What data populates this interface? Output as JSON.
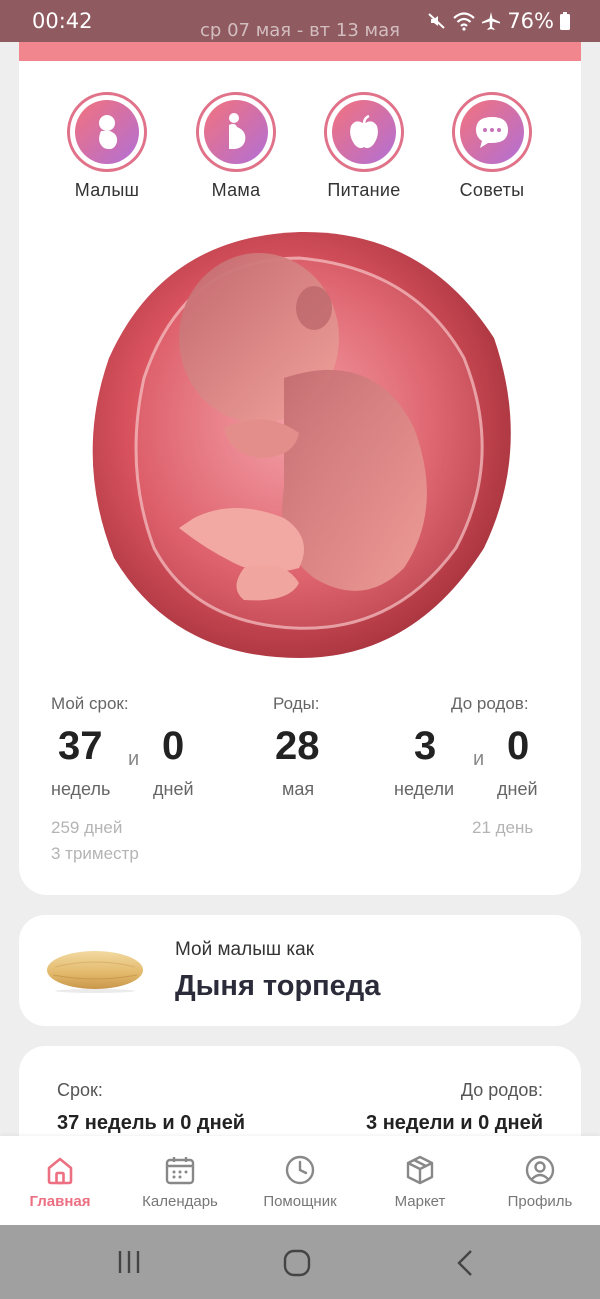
{
  "status_bar": {
    "time": "00:42",
    "battery": "76%"
  },
  "header": {
    "week_range": "ср 07 мая - вт 13 мая"
  },
  "categories": [
    {
      "label": "Малыш",
      "icon": "baby-icon"
    },
    {
      "label": "Мама",
      "icon": "pregnant-woman-icon"
    },
    {
      "label": "Питание",
      "icon": "apple-icon"
    },
    {
      "label": "Советы",
      "icon": "chat-bubble-icon"
    }
  ],
  "stats": {
    "term": {
      "label": "Мой срок:",
      "weeks": "37",
      "and": "и",
      "days": "0",
      "weeks_unit": "недель",
      "days_unit": "дней",
      "total_days": "259 дней",
      "trimester": "3 триместр"
    },
    "birth": {
      "label": "Роды:",
      "day": "28",
      "month": "мая"
    },
    "until": {
      "label": "До родов:",
      "weeks": "3",
      "and": "и",
      "days": "0",
      "weeks_unit": "недели",
      "days_unit": "дней",
      "total_days": "21 день"
    }
  },
  "baby_size": {
    "subtitle": "Мой малыш как",
    "title": "Дыня торпеда"
  },
  "term_card": {
    "term_label": "Срок:",
    "term_value": "37 недель и 0 дней",
    "until_label": "До родов:",
    "until_value": "3 недели и 0 дней"
  },
  "bottom_nav": [
    {
      "label": "Главная",
      "icon": "home-icon",
      "active": true
    },
    {
      "label": "Календарь",
      "icon": "calendar-icon",
      "active": false
    },
    {
      "label": "Помощник",
      "icon": "clock-icon",
      "active": false
    },
    {
      "label": "Маркет",
      "icon": "box-icon",
      "active": false
    },
    {
      "label": "Профиль",
      "icon": "profile-icon",
      "active": false
    }
  ],
  "colors": {
    "accent": "#ec6f82",
    "status_bar": "#8f5a60",
    "strip": "#f1868e"
  }
}
